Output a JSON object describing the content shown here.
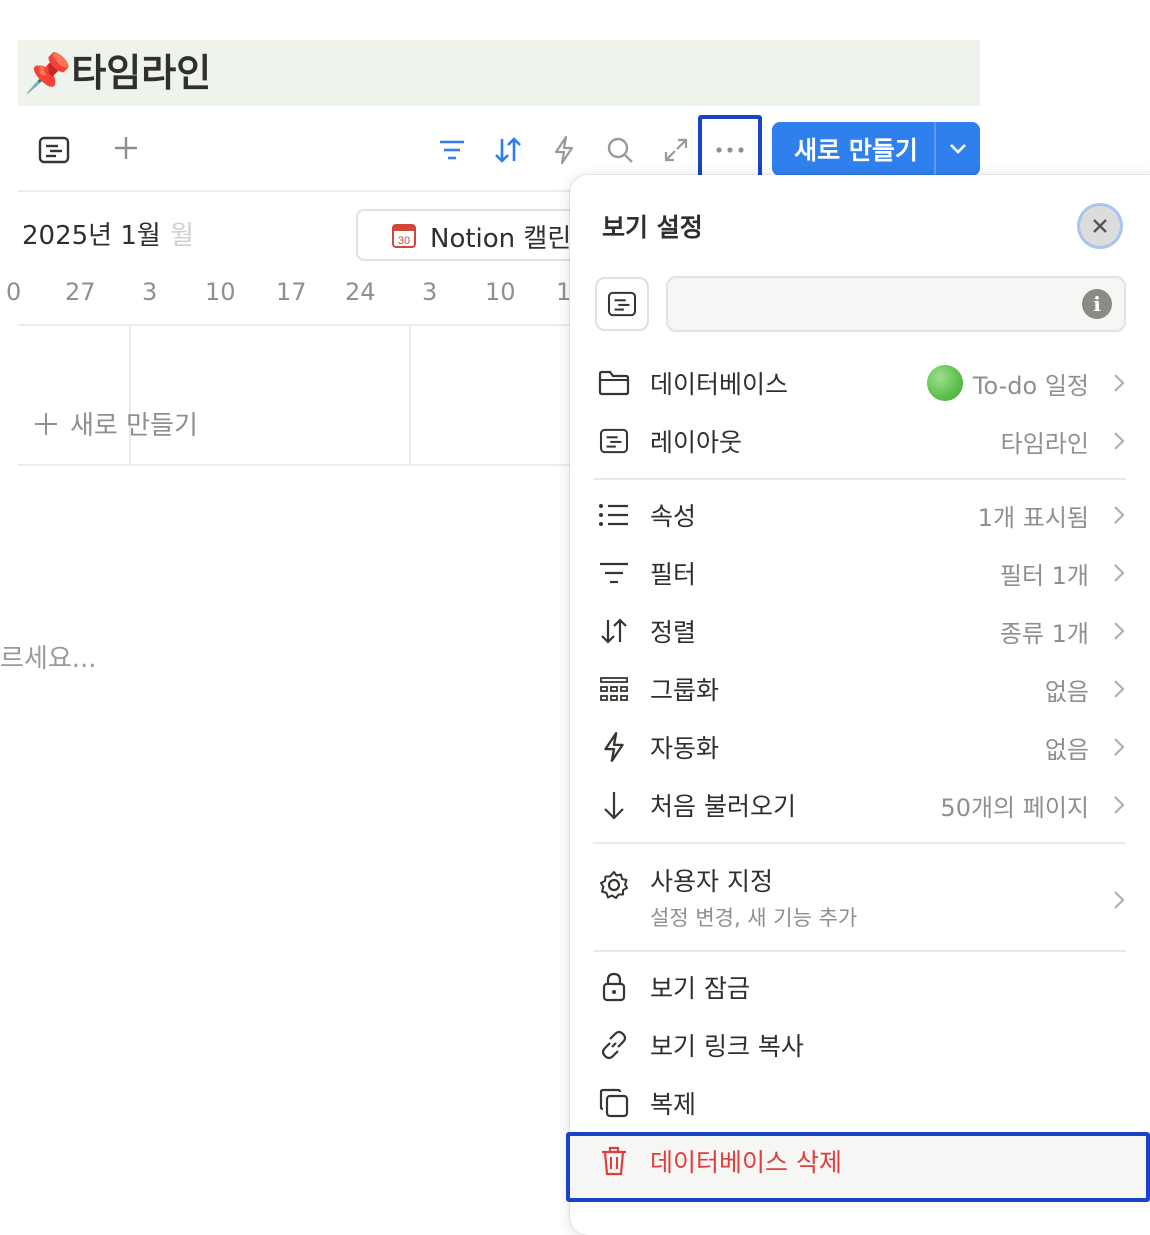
{
  "page": {
    "title_emoji": "📌",
    "title": "타임라인"
  },
  "toolbar": {
    "view_icon": "layout-icon",
    "add_view_icon": "plus-icon",
    "filter_icon": "filter-icon",
    "sort_icon": "sort-icon",
    "automation_icon": "lightning-icon",
    "search_icon": "search-icon",
    "expand_icon": "expand-icon",
    "more_icon": "more-icon",
    "new_button_label": "새로 만들기",
    "accent_color": "#2f80ed"
  },
  "timeline": {
    "month_label": "2025년 1월",
    "month_fade": "월",
    "calendar_chip_label": "Notion 캘린",
    "days": [
      "0",
      "27",
      "3",
      "10",
      "17",
      "24",
      "3",
      "10",
      "1"
    ],
    "add_new_label": "새로 만들기",
    "hint_text": "르세요..."
  },
  "panel": {
    "title": "보기 설정",
    "close_icon": "close-icon",
    "name_input_value": "",
    "info_icon": "info-icon",
    "rows_group1": [
      {
        "icon": "folder-icon",
        "label": "데이터베이스",
        "value": "To-do 일정",
        "has_dot": true
      },
      {
        "icon": "layout-icon",
        "label": "레이아웃",
        "value": "타임라인"
      }
    ],
    "rows_group2": [
      {
        "icon": "list-icon",
        "label": "속성",
        "value": "1개 표시됨"
      },
      {
        "icon": "filter-icon",
        "label": "필터",
        "value": "필터 1개"
      },
      {
        "icon": "sort-icon",
        "label": "정렬",
        "value": "종류 1개"
      },
      {
        "icon": "group-icon",
        "label": "그룹화",
        "value": "없음"
      },
      {
        "icon": "lightning-icon",
        "label": "자동화",
        "value": "없음"
      },
      {
        "icon": "arrow-down-icon",
        "label": "처음 불러오기",
        "value": "50개의 페이지"
      }
    ],
    "customize": {
      "icon": "gear-icon",
      "label": "사용자 지정",
      "sublabel": "설정 변경, 새 기능 추가"
    },
    "rows_group4": [
      {
        "icon": "lock-icon",
        "label": "보기 잠금"
      },
      {
        "icon": "link-icon",
        "label": "보기 링크 복사"
      },
      {
        "icon": "duplicate-icon",
        "label": "복제"
      }
    ],
    "delete": {
      "icon": "trash-icon",
      "label": "데이터베이스 삭제",
      "color": "#e03e3e"
    },
    "highlight_color": "#1744c8"
  }
}
